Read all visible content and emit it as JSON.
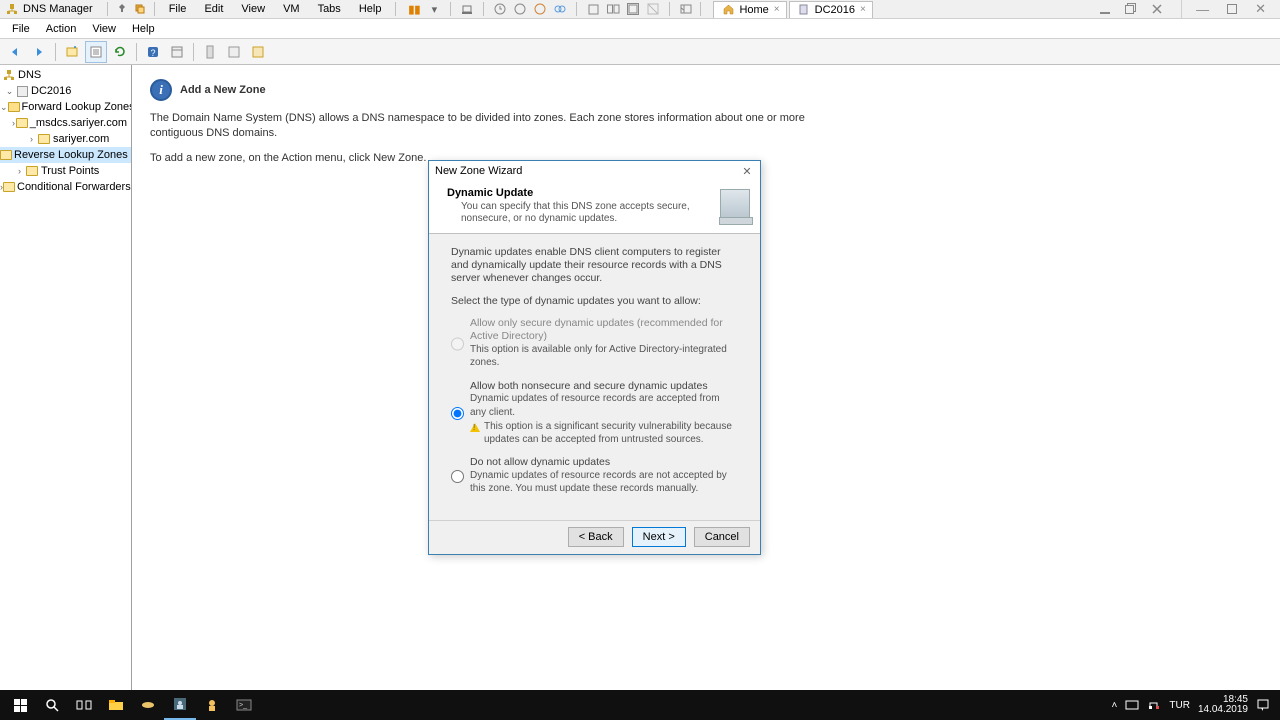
{
  "vmBar": {
    "appTitle": "DNS Manager",
    "menuItems": [
      "File",
      "Edit",
      "View",
      "VM",
      "Tabs",
      "Help"
    ],
    "tabs": [
      {
        "icon": "home",
        "label": "Home"
      },
      {
        "icon": "server",
        "label": "DC2016"
      }
    ]
  },
  "appMenu": [
    "File",
    "Action",
    "View",
    "Help"
  ],
  "tree": {
    "root": "DNS",
    "server": "DC2016",
    "nodes": {
      "fwd": "Forward Lookup Zones",
      "msdcs": "_msdcs.sariyer.com",
      "sariyer": "sariyer.com",
      "rev": "Reverse Lookup Zones",
      "trust": "Trust Points",
      "cond": "Conditional Forwarders"
    }
  },
  "content": {
    "heading": "Add a New Zone",
    "p1": "The Domain Name System (DNS) allows a DNS namespace to be divided into zones. Each zone stores information about one or more contiguous DNS domains.",
    "p2": "To add a new zone, on the Action menu, click New Zone."
  },
  "wizard": {
    "title": "New Zone Wizard",
    "headerTitle": "Dynamic Update",
    "headerDesc": "You can specify that this DNS zone accepts secure, nonsecure, or no dynamic updates.",
    "bodyIntro": "Dynamic updates enable DNS client computers to register and dynamically update their resource records with a DNS server whenever changes occur.",
    "bodyPrompt": "Select the type of dynamic updates you want to allow:",
    "opt1": {
      "label": "Allow only secure dynamic updates (recommended for Active Directory)",
      "desc": "This option is available only for Active Directory-integrated zones."
    },
    "opt2": {
      "label": "Allow both nonsecure and secure dynamic updates",
      "desc": "Dynamic updates of resource records are accepted from any client.",
      "warn": "This option is a significant security vulnerability because updates can be accepted from untrusted sources."
    },
    "opt3": {
      "label": "Do not allow dynamic updates",
      "desc": "Dynamic updates of resource records are not accepted by this zone. You must update these records manually."
    },
    "back": "< Back",
    "next": "Next >",
    "cancel": "Cancel"
  },
  "taskbar": {
    "lang": "TUR",
    "time": "18:45",
    "date": "14.04.2019"
  }
}
